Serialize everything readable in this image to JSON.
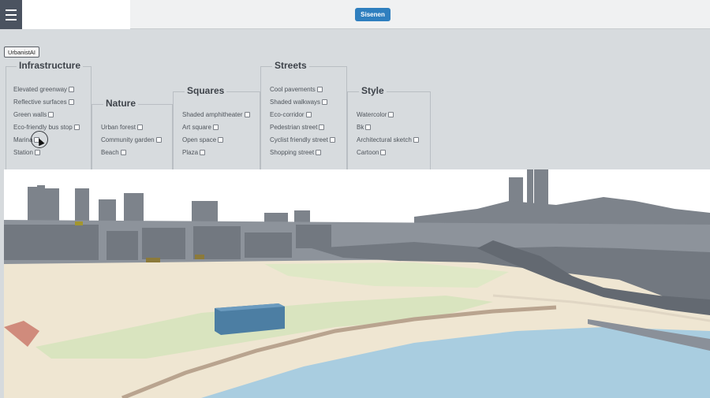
{
  "topbar": {
    "menu_icon": "hamburger-menu-icon",
    "main_button": "Sisenen"
  },
  "app_label": "UrbanistAI",
  "categories": {
    "infrastructure": {
      "title": "Infrastructure",
      "options": [
        "Elevated greenway",
        "Reflective surfaces",
        "Green walls",
        "Eco-friendly bus stop",
        "Marina",
        "Station"
      ]
    },
    "nature": {
      "title": "Nature",
      "options": [
        "Urban forest",
        "Community garden",
        "Beach"
      ]
    },
    "squares": {
      "title": "Squares",
      "options": [
        "Shaded amphitheater",
        "Art square",
        "Open space",
        "Plaza"
      ]
    },
    "streets": {
      "title": "Streets",
      "options": [
        "Cool pavements",
        "Shaded walkways",
        "Eco-corridor",
        "Pedestrian street",
        "Cyclist friendly street",
        "Shopping street"
      ]
    },
    "style": {
      "title": "Style",
      "options": [
        "Watercolor",
        "Bk",
        "Architectural sketch",
        "Cartoon"
      ]
    }
  },
  "colors": {
    "topbar_bg": "#f0f1f2",
    "menu_bg": "#4b5360",
    "accent": "#2f7fbf",
    "panel_bg": "#d7dbde",
    "sea": "#a9cde0",
    "sand": "#efe6d2",
    "park": "#d9e4bf",
    "buildings": "#7d838b"
  }
}
